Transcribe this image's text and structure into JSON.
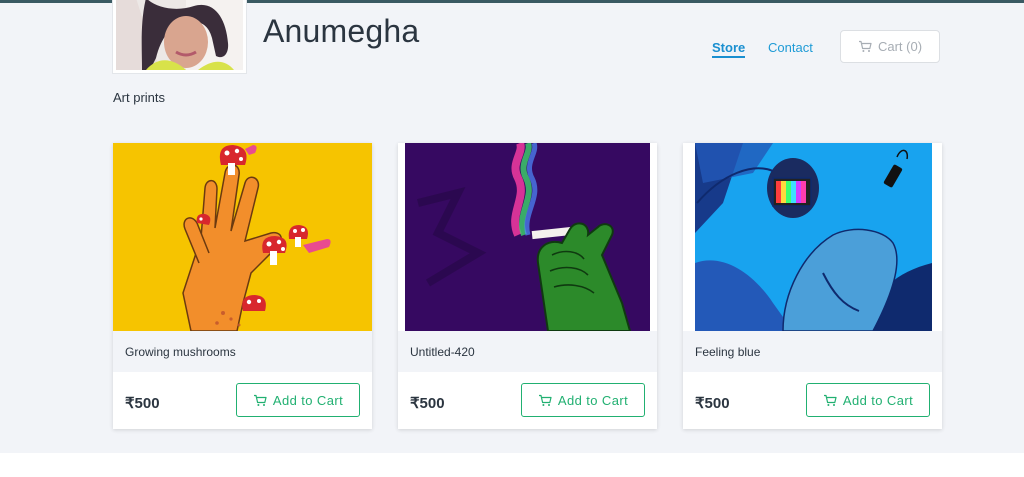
{
  "header": {
    "store_name": "Anumegha",
    "nav": {
      "store": "Store",
      "contact": "Contact"
    },
    "cart_label": "Cart (0)"
  },
  "tagline": "Art prints",
  "products": [
    {
      "title": "Growing mushrooms",
      "price": "₹500",
      "button": "Add to Cart"
    },
    {
      "title": "Untitled-420",
      "price": "₹500",
      "button": "Add to Cart"
    },
    {
      "title": "Feeling blue",
      "price": "₹500",
      "button": "Add to Cart"
    }
  ],
  "colors": {
    "accent": "#1a8fd0",
    "button_green": "#21b071",
    "background": "#f2f4f8",
    "text": "#2b3540"
  },
  "icons": {
    "cart": "cart-icon"
  }
}
